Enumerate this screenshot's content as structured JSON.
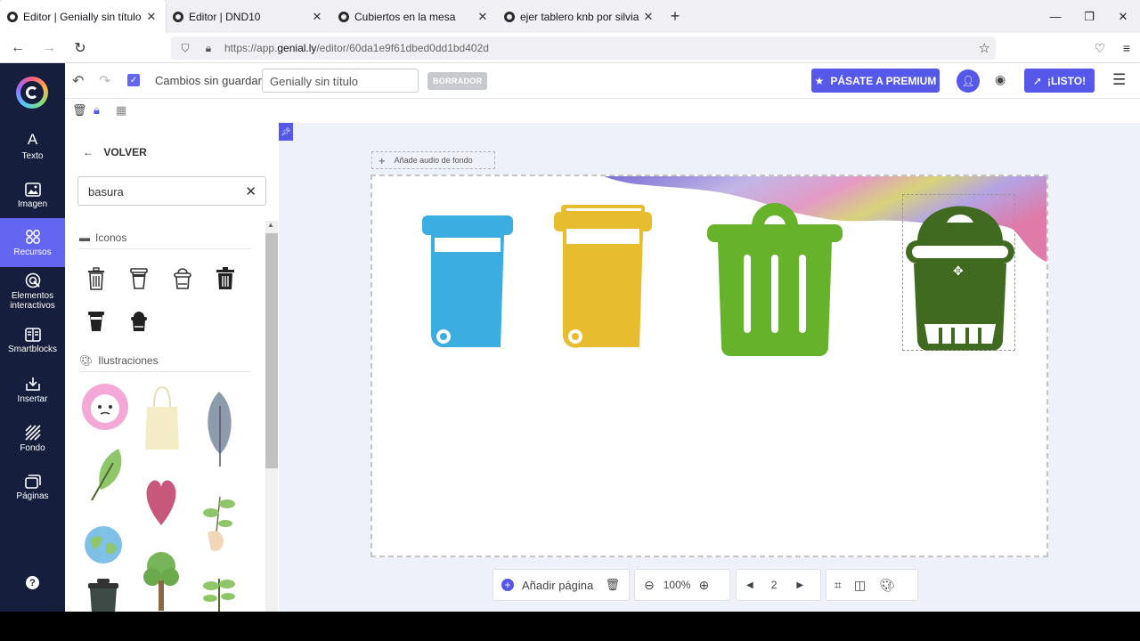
{
  "browser": {
    "tabs": [
      {
        "label": "Editor | Genially sin título",
        "active": true
      },
      {
        "label": "Editor | DND10",
        "active": false
      },
      {
        "label": "Cubiertos en la mesa",
        "active": false
      },
      {
        "label": "ejer tablero knb por silvia en Ge",
        "active": false
      }
    ],
    "url_prefix": "https://app.",
    "url_domain": "genial.ly",
    "url_path": "/editor/60da1e9f61dbed0dd1bd402d"
  },
  "sidebar": {
    "items": [
      {
        "label": "Texto",
        "icon": "A"
      },
      {
        "label": "Imagen",
        "icon": "image-icon"
      },
      {
        "label": "Recursos",
        "icon": "resources-icon",
        "active": true
      },
      {
        "label": "Elementos interactivos",
        "icon": "interactive-icon"
      },
      {
        "label": "Smartblocks",
        "icon": "smartblocks-icon"
      },
      {
        "label": "Insertar",
        "icon": "insert-icon"
      },
      {
        "label": "Fondo",
        "icon": "background-icon"
      },
      {
        "label": "Páginas",
        "icon": "pages-icon"
      }
    ],
    "help": "?"
  },
  "toolbar": {
    "status": "Cambios sin guardar",
    "title_value": "Genially sin título",
    "badge": "BORRADOR",
    "premium_label": "PÁSATE A PREMIUM",
    "done_label": "¡LISTO!"
  },
  "panel": {
    "back_label": "VOLVER",
    "search_value": "basura",
    "icons_section": "Iconos",
    "illustrations_section": "Ilustraciones"
  },
  "canvas": {
    "audio_label": "Añade audio de fondo",
    "colors": {
      "blue": "#3bade0",
      "yellow": "#e7bc2f",
      "green": "#67b22b",
      "dark_green": "#3f6a1f"
    }
  },
  "bottom": {
    "add_page": "Añadir página",
    "zoom": "100%",
    "page": "2"
  }
}
